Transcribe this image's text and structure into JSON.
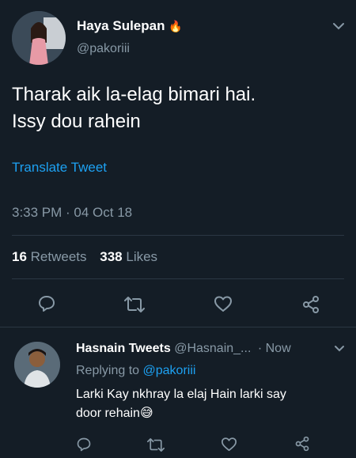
{
  "tweet": {
    "author_name": "Haya Sulepan",
    "author_emoji": "🔥",
    "handle": "@pakoriii",
    "text_line1": "Tharak aik la-elag bimari hai.",
    "text_line2": "Issy dou rahein",
    "translate_label": "Translate Tweet",
    "timestamp": "3:33 PM · 04 Oct 18",
    "retweets_count": "16",
    "retweets_label": "Retweets",
    "likes_count": "338",
    "likes_label": "Likes"
  },
  "reply": {
    "author_name": "Hasnain Tweets",
    "handle": "@Hasnain_...",
    "time": "· Now",
    "replying_prefix": "Replying to",
    "replying_handle": "@pakoriii",
    "text_line1": "Larki Kay nkhray la elaj Hain larki say",
    "text_line2": "door rehain",
    "text_emoji": "😅"
  },
  "icons": [
    "chevron-down-icon",
    "reply-icon",
    "retweet-icon",
    "like-icon",
    "share-icon"
  ],
  "colors": {
    "background": "#141d26",
    "link": "#1da1f2",
    "muted": "#8899a6",
    "divider": "#2b3743"
  }
}
